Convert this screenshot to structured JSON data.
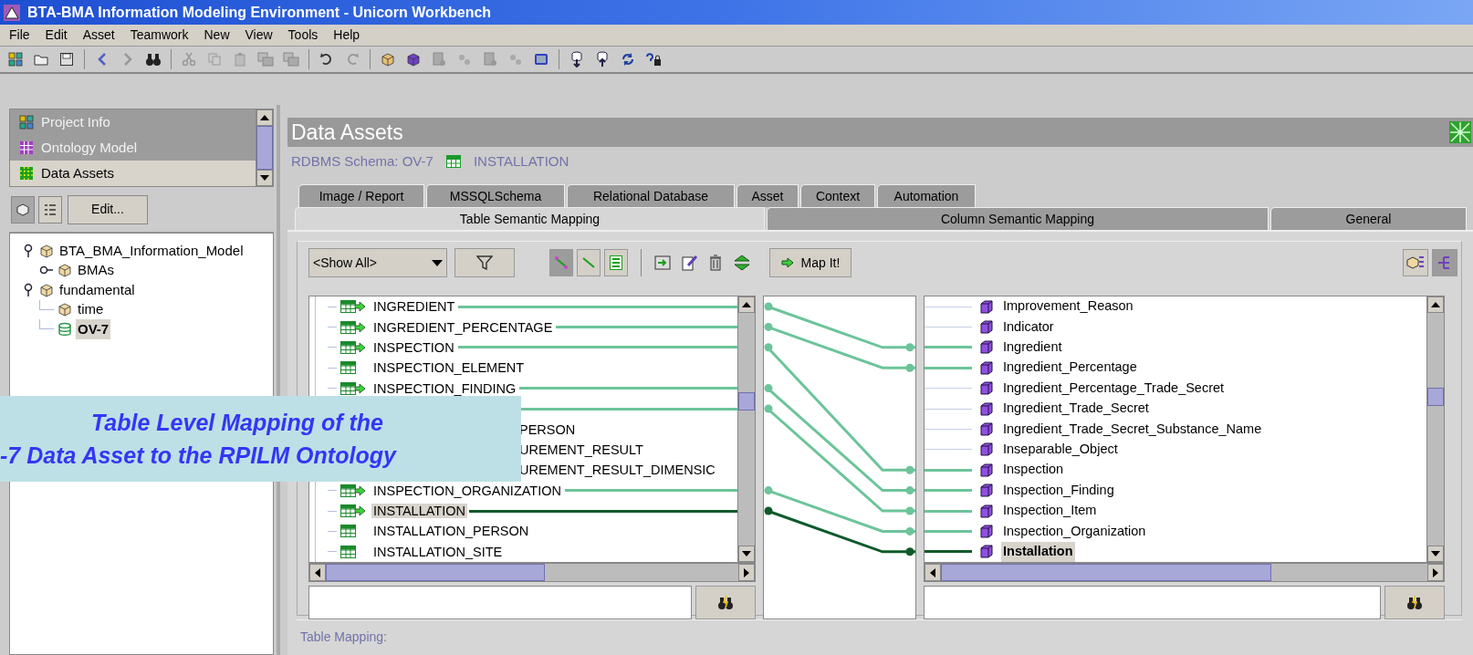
{
  "window": {
    "title": "BTA-BMA Information Modeling Environment - Unicorn Workbench"
  },
  "menu": [
    "File",
    "Edit",
    "Asset",
    "Teamwork",
    "New",
    "View",
    "Tools",
    "Help"
  ],
  "navigator": {
    "items": [
      {
        "label": "Project Info",
        "selected": false
      },
      {
        "label": "Ontology Model",
        "selected": false
      },
      {
        "label": "Data Assets",
        "selected": true
      }
    ],
    "view_toggles": [
      {
        "selected": true
      },
      {
        "selected": false
      }
    ],
    "edit_button": "Edit..."
  },
  "project_tree": [
    {
      "label": "BTA_BMA_Information_Model",
      "kind": "package",
      "expanded": true,
      "selected": false,
      "children": [
        {
          "label": "BMAs",
          "kind": "package",
          "expanded": false,
          "selected": false
        }
      ]
    },
    {
      "label": "fundamental",
      "kind": "package",
      "expanded": true,
      "selected": false,
      "children": [
        {
          "label": "time",
          "kind": "package",
          "selected": false
        },
        {
          "label": "OV-7",
          "kind": "database",
          "selected": true
        }
      ]
    }
  ],
  "header": {
    "title": "Data Assets",
    "schema": "RDBMS Schema: OV-7",
    "table": "INSTALLATION"
  },
  "tab_rows": [
    [
      {
        "label": "Image / Report",
        "selected": false
      },
      {
        "label": "MSSQLSchema",
        "selected": false
      },
      {
        "label": "Relational Database",
        "selected": false
      },
      {
        "label": "Asset",
        "selected": false
      },
      {
        "label": "Context",
        "selected": false
      },
      {
        "label": "Automation",
        "selected": false
      }
    ],
    [
      {
        "label": "Table Semantic Mapping",
        "selected": true
      },
      {
        "label": "Column Semantic Mapping",
        "selected": false
      },
      {
        "label": "General",
        "selected": false
      }
    ]
  ],
  "mapping": {
    "filter": "<Show All>",
    "view_toggles": [
      {
        "selected": true
      },
      {
        "selected": false
      },
      {
        "selected": false
      }
    ],
    "map_button": "Map It!",
    "panel_toggles": [
      {
        "selected": false
      },
      {
        "selected": true
      }
    ],
    "source_rows": [
      {
        "label": "INGREDIENT",
        "mapped": true,
        "selected": false,
        "covered": false
      },
      {
        "label": "INGREDIENT_PERCENTAGE",
        "mapped": true,
        "selected": false,
        "covered": false
      },
      {
        "label": "INSPECTION",
        "mapped": true,
        "selected": false,
        "covered": false
      },
      {
        "label": "INSPECTION_ELEMENT",
        "mapped": false,
        "selected": false,
        "covered": false
      },
      {
        "label": "INSPECTION_FINDING",
        "mapped": true,
        "selected": false,
        "covered": false
      },
      {
        "mapped": true,
        "selected": false,
        "covered": true
      },
      {
        "label": "PERSON",
        "mapped": false,
        "selected": false,
        "covered": true
      },
      {
        "label": "UREMENT_RESULT",
        "mapped": false,
        "selected": false,
        "covered": true
      },
      {
        "label": "UREMENT_RESULT_DIMENSIC",
        "mapped": false,
        "selected": false,
        "covered": true
      },
      {
        "label": "INSPECTION_ORGANIZATION",
        "mapped": true,
        "selected": false,
        "covered": false
      },
      {
        "label": "INSTALLATION",
        "mapped": true,
        "selected": true,
        "covered": false
      },
      {
        "label": "INSTALLATION_PERSON",
        "mapped": false,
        "selected": false,
        "covered": false
      },
      {
        "label": "INSTALLATION_SITE",
        "mapped": false,
        "selected": false,
        "covered": false
      }
    ],
    "target_rows": [
      {
        "label": "Improvement_Reason",
        "mapped": false,
        "selected": false
      },
      {
        "label": "Indicator",
        "mapped": false,
        "selected": false
      },
      {
        "label": "Ingredient",
        "mapped": true,
        "selected": false
      },
      {
        "label": "Ingredient_Percentage",
        "mapped": true,
        "selected": false
      },
      {
        "label": "Ingredient_Percentage_Trade_Secret",
        "mapped": false,
        "selected": false
      },
      {
        "label": "Ingredient_Trade_Secret",
        "mapped": false,
        "selected": false
      },
      {
        "label": "Ingredient_Trade_Secret_Substance_Name",
        "mapped": false,
        "selected": false
      },
      {
        "label": "Inseparable_Object",
        "mapped": false,
        "selected": false
      },
      {
        "label": "Inspection",
        "mapped": true,
        "selected": false
      },
      {
        "label": "Inspection_Finding",
        "mapped": true,
        "selected": false
      },
      {
        "label": "Inspection_Item",
        "mapped": true,
        "selected": false
      },
      {
        "label": "Inspection_Organization",
        "mapped": true,
        "selected": false
      },
      {
        "label": "Installation",
        "mapped": true,
        "selected": true
      }
    ]
  },
  "table_mapping": {
    "label": "Table Mapping:"
  },
  "annotation": {
    "lines": [
      "Table Level Mapping of the",
      "-7 Data Asset to the RPILM Ontology"
    ]
  }
}
